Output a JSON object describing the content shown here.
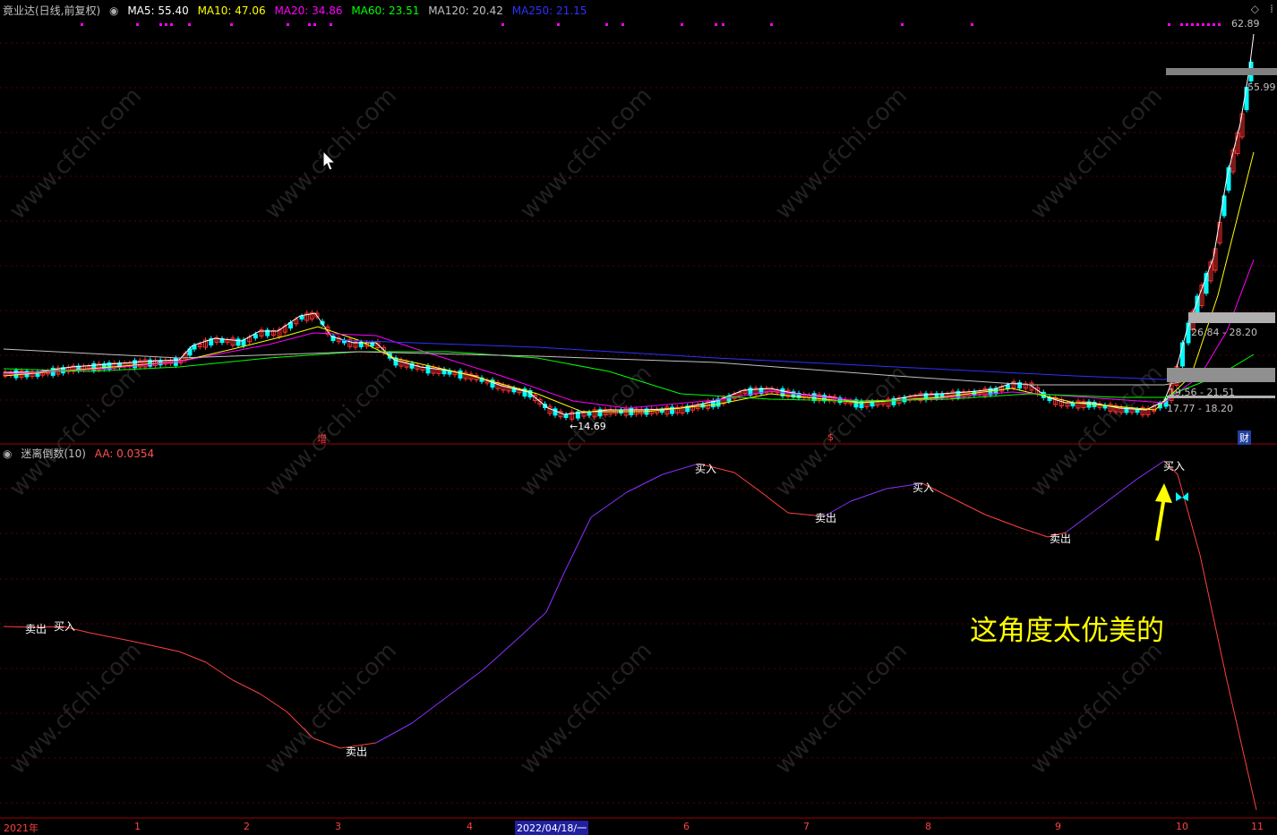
{
  "header": {
    "title": "竟业达(日线,前复权)",
    "ma5": "MA5: 55.40",
    "ma10": "MA10: 47.06",
    "ma20": "MA20: 34.86",
    "ma60": "MA60: 23.51",
    "ma120": "MA120: 20.42",
    "ma250": "MA250: 21.15",
    "colors": {
      "ma5": "#ffffff",
      "ma10": "#ffff00",
      "ma20": "#ff00ff",
      "ma60": "#00ff00",
      "ma120": "#c0c0c0",
      "ma250": "#3030ff"
    }
  },
  "price_panel": {
    "high_label": "62.89",
    "price_label_right": "55.99",
    "low_label": "14.69",
    "ranges": [
      "26.84 - 28.20",
      "19.56 - 21.51",
      "17.77 - 18.20"
    ],
    "markers": {
      "zeng": "增",
      "dollar": "$",
      "cai": "财"
    },
    "icons": {
      "diamond": "diamond-icon"
    }
  },
  "indicator_panel": {
    "title": "迷离倒数(10)",
    "aa": "AA: 0.0354",
    "signals": [
      {
        "text": "卖出"
      },
      {
        "text": "买入"
      },
      {
        "text": "卖出"
      },
      {
        "text": "买入"
      },
      {
        "text": "卖出"
      },
      {
        "text": "买入"
      },
      {
        "text": "卖出"
      },
      {
        "text": "买入"
      }
    ],
    "annotation": "这角度太优美的"
  },
  "x_axis": {
    "labels": [
      "2021年",
      "1",
      "2",
      "3",
      "4",
      "2022/04/18/一",
      "6",
      "7",
      "8",
      "9",
      "10",
      "11"
    ]
  },
  "watermark": "www.cfchi.com",
  "chart_data": [
    {
      "type": "line",
      "name": "竟业达 price (candlestick, approximate closes)",
      "x": [
        "2021-12",
        "2022-01",
        "2022-02",
        "2022-03",
        "2022-04",
        "2022-05",
        "2022-06",
        "2022-07",
        "2022-08",
        "2022-09",
        "2022-10",
        "2022-10-mid",
        "2022-10-end",
        "2022-11"
      ],
      "values": [
        22.0,
        23.5,
        28.5,
        27.0,
        22.0,
        15.0,
        18.5,
        19.5,
        19.0,
        21.5,
        18.0,
        20.0,
        38.0,
        55.99
      ],
      "ylim": [
        14.69,
        62.89
      ]
    },
    {
      "type": "line",
      "name": "迷离倒数(10)",
      "x": [
        "2021-12",
        "2022-01",
        "2022-02",
        "2022-03",
        "2022-04",
        "2022-05",
        "2022-06",
        "2022-07",
        "2022-08",
        "2022-09",
        "2022-10",
        "2022-11"
      ],
      "values": [
        0.3,
        0.24,
        0.12,
        0.05,
        0.18,
        0.42,
        0.67,
        0.59,
        0.64,
        0.56,
        0.68,
        0.04
      ]
    }
  ]
}
